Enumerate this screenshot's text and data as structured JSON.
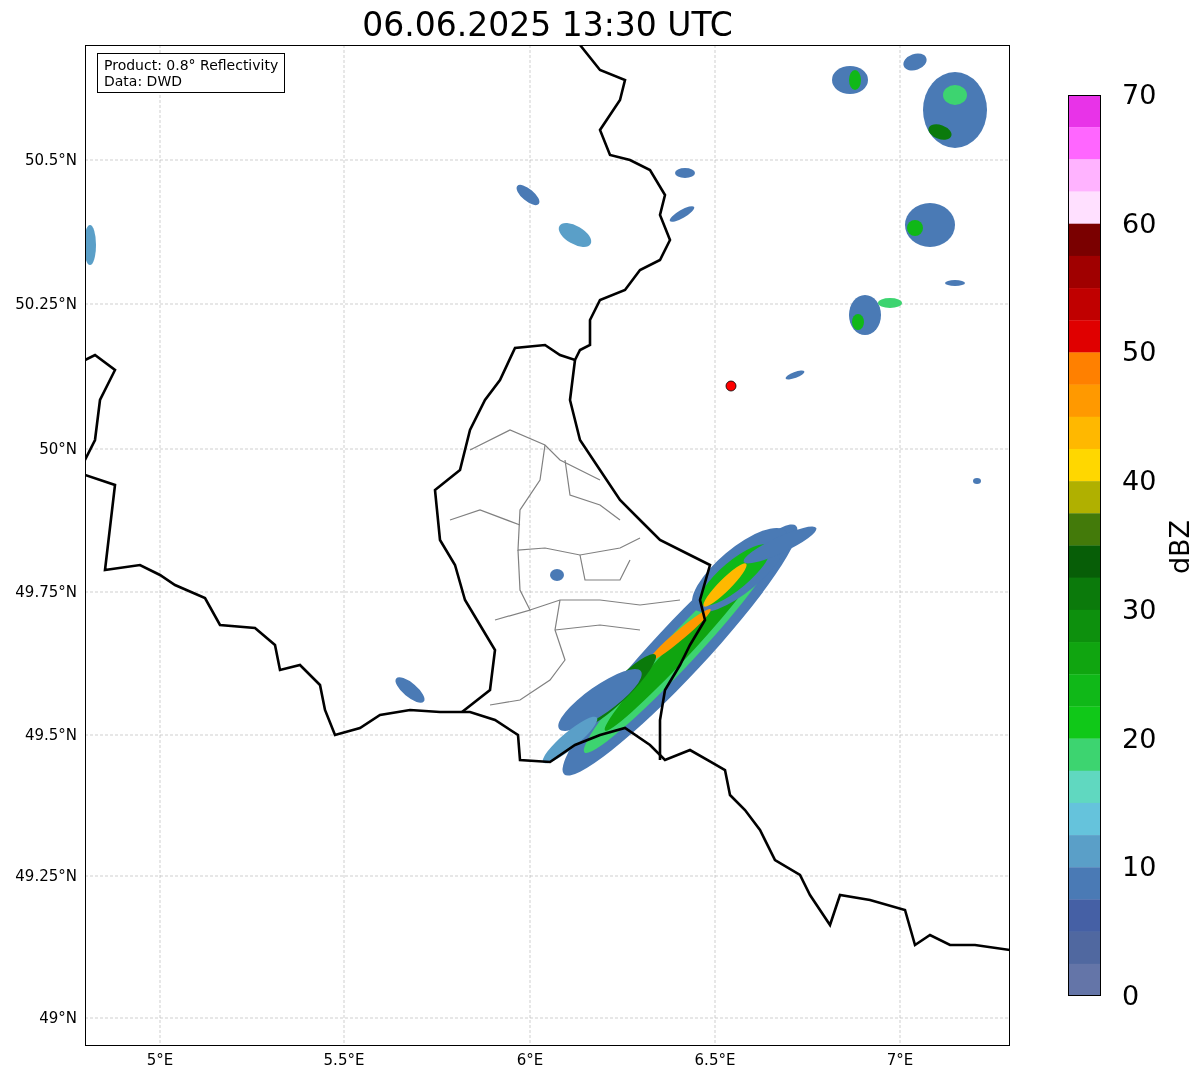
{
  "title": "06.06.2025 13:30 UTC",
  "info_box": [
    "Product: 0.8° Reflectivity",
    "Data: DWD"
  ],
  "map": {
    "lat_labels": [
      "50.5°N",
      "50.25°N",
      "50°N",
      "49.75°N",
      "49.5°N",
      "49.25°N",
      "49°N"
    ],
    "lon_labels": [
      "5°E",
      "5.5°E",
      "6°E",
      "6.5°E",
      "7°E"
    ]
  },
  "colorbar": {
    "label": "dBZ",
    "ticks": [
      "70",
      "60",
      "50",
      "40",
      "30",
      "20",
      "10",
      "0"
    ],
    "bins": [
      {
        "color": "#e833e8"
      },
      {
        "color": "#ff66ff"
      },
      {
        "color": "#ffb3ff"
      },
      {
        "color": "#ffe0ff"
      },
      {
        "color": "#7a0000"
      },
      {
        "color": "#a00000"
      },
      {
        "color": "#c00000"
      },
      {
        "color": "#e00000"
      },
      {
        "color": "#ff8000"
      },
      {
        "color": "#ff9900"
      },
      {
        "color": "#ffb800"
      },
      {
        "color": "#ffd700"
      },
      {
        "color": "#b0b000"
      },
      {
        "color": "#437a0a"
      },
      {
        "color": "#075e07"
      },
      {
        "color": "#0b7a0b"
      },
      {
        "color": "#0d900d"
      },
      {
        "color": "#10a510"
      },
      {
        "color": "#10b818"
      },
      {
        "color": "#10c818"
      },
      {
        "color": "#3dd470"
      },
      {
        "color": "#60d8c0"
      },
      {
        "color": "#65c3dc"
      },
      {
        "color": "#5a9fc8"
      },
      {
        "color": "#4a7ab5"
      },
      {
        "color": "#4560a5"
      },
      {
        "color": "#5068a0"
      },
      {
        "color": "#6475a8"
      }
    ]
  }
}
